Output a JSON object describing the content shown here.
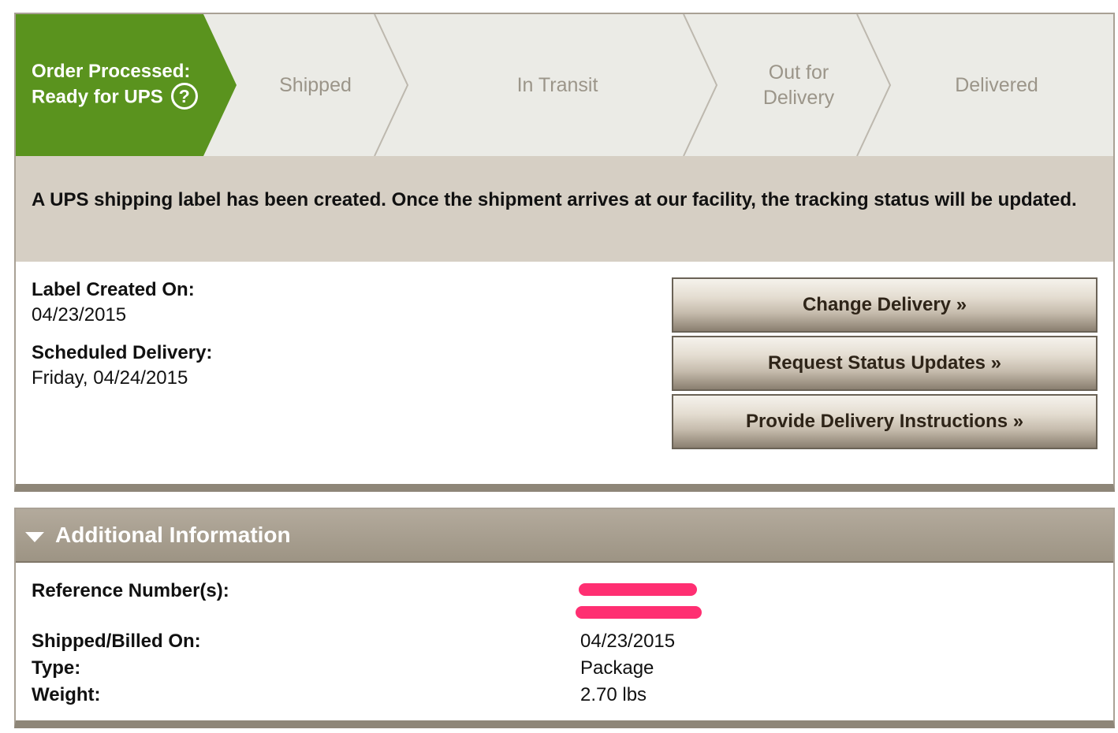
{
  "colors": {
    "active_stage": "#5a931e",
    "stage_bg": "#ebebe6",
    "message_bg": "#d6cfc4",
    "header_bg": "#a89f90",
    "redaction": "#ff2f72"
  },
  "progress": {
    "stages": [
      {
        "label_line1": "Order Processed:",
        "label_line2": "Ready for UPS",
        "active": true,
        "help_icon": "question-circle-icon",
        "help_glyph": "?"
      },
      {
        "label": "Shipped",
        "active": false
      },
      {
        "label": "In Transit",
        "active": false
      },
      {
        "label_line1": "Out for",
        "label_line2": "Delivery",
        "active": false
      },
      {
        "label": "Delivered",
        "active": false
      }
    ]
  },
  "status_message": "A UPS shipping label has been created. Once the shipment arrives at our facility, the tracking status will be updated.",
  "details": {
    "label_created_label": "Label Created On:",
    "label_created_value": "04/23/2015",
    "scheduled_label": "Scheduled Delivery:",
    "scheduled_value": "Friday, 04/24/2015"
  },
  "actions": {
    "change_delivery": "Change Delivery »",
    "request_updates": "Request Status Updates »",
    "delivery_instructions": "Provide Delivery Instructions »"
  },
  "additional_info": {
    "title": "Additional Information",
    "toggle_icon": "triangle-down-icon",
    "reference_label": "Reference Number(s):",
    "shipped_label": "Shipped/Billed On:",
    "shipped_value": "04/23/2015",
    "type_label": "Type:",
    "type_value": "Package",
    "weight_label": "Weight:",
    "weight_value": "2.70 lbs"
  }
}
